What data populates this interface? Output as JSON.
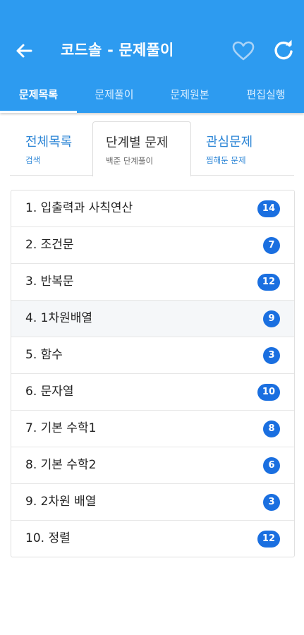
{
  "header": {
    "title": "코드솔 - 문제풀이",
    "back_icon": "arrow-left-icon",
    "favorite_icon": "heart-outline-icon",
    "refresh_icon": "refresh-icon",
    "color": "#2d9bf0"
  },
  "tabs": [
    {
      "label": "문제목록",
      "active": true
    },
    {
      "label": "문제풀이",
      "active": false
    },
    {
      "label": "문제원본",
      "active": false
    },
    {
      "label": "편집실행",
      "active": false
    }
  ],
  "subtabs": [
    {
      "label": "전체목록",
      "sub": "검색",
      "active": false
    },
    {
      "label": "단계별 문제",
      "sub": "백준 단계풀이",
      "active": true
    },
    {
      "label": "관심문제",
      "sub": "찜해둔 문제",
      "active": false
    }
  ],
  "items": [
    {
      "label": "1. 입출력과 사칙연산",
      "count": "14"
    },
    {
      "label": "2. 조건문",
      "count": "7"
    },
    {
      "label": "3. 반복문",
      "count": "12"
    },
    {
      "label": "4. 1차원배열",
      "count": "9"
    },
    {
      "label": "5. 함수",
      "count": "3"
    },
    {
      "label": "6. 문자열",
      "count": "10"
    },
    {
      "label": "7. 기본 수학1",
      "count": "8"
    },
    {
      "label": "8. 기본 수학2",
      "count": "6"
    },
    {
      "label": "9. 2차원 배열",
      "count": "3"
    },
    {
      "label": "10. 정렬",
      "count": "12"
    }
  ],
  "badge_color": "#1a6fe0"
}
